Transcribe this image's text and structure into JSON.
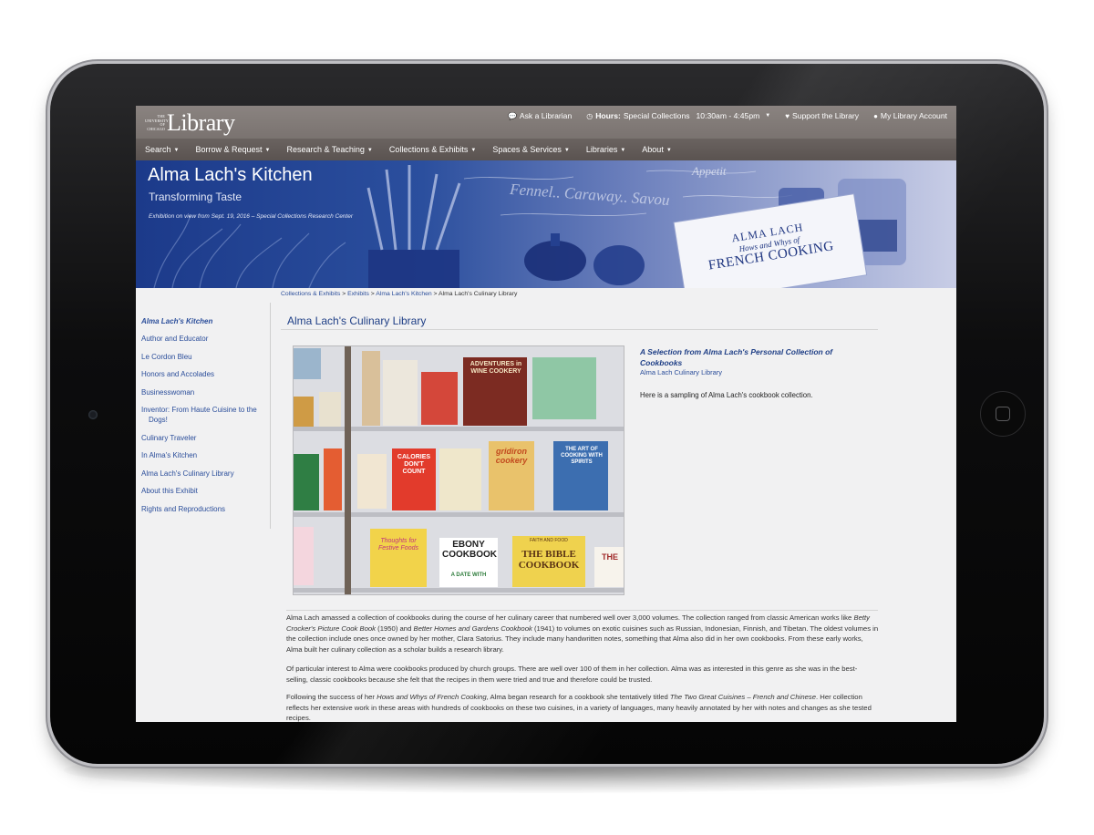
{
  "topbar": {
    "logo_small": [
      "THE",
      "UNIVERSITY",
      "OF",
      "CHICAGO"
    ],
    "logo_big": "Library",
    "ask_label": "Ask a Librarian",
    "hours_label": "Hours:",
    "hours_value": "Special Collections",
    "hours_time": "10:30am - 4:45pm",
    "support_label": "Support the Library",
    "account_label": "My Library Account"
  },
  "nav": {
    "items": [
      "Search",
      "Borrow & Request",
      "Research & Teaching",
      "Collections & Exhibits",
      "Spaces & Services",
      "Libraries",
      "About"
    ]
  },
  "banner": {
    "title": "Alma Lach's Kitchen",
    "subtitle": "Transforming Taste",
    "note": "Exhibition on view from Sept. 19, 2016 – Special Collections Research Center",
    "book_text": [
      "ALMA LACH",
      "Hows and Whys of",
      "FRENCH COOKING"
    ],
    "wall_text": [
      "Fennel.. Caraway.. Savou",
      "Appetit"
    ]
  },
  "breadcrumb": {
    "items": [
      "Collections & Exhibits",
      "Exhibits",
      "Alma Lach's Kitchen"
    ],
    "current": "Alma Lach's Culinary Library",
    "sep": " > "
  },
  "sidebar": {
    "items": [
      "Alma Lach's Kitchen",
      "Author and Educator",
      "Le Cordon Bleu",
      "Honors and Accolades",
      "Businesswoman",
      "Inventor: From Haute Cuisine to the",
      "Culinary Traveler",
      "In Alma's Kitchen",
      "Alma Lach's Culinary Library",
      "About this Exhibit",
      "Rights and Reproductions"
    ],
    "inventor_line2": "Dogs!"
  },
  "main": {
    "title": "Alma Lach's Culinary Library",
    "selection_title": "A Selection from Alma Lach's Personal Collection of Cookbooks",
    "selection_link": "Alma Lach Culinary Library",
    "selection_text": "Here is a sampling of Alma Lach's cookbook collection.",
    "book_covers": [
      "ADVENTURES in WINE COOKERY",
      "CALORIES DON'T COUNT",
      "gridiron cookery",
      "THE ART OF COOKING WITH SPIRITS",
      "EBONY COOKBOOK",
      "A DATE WITH",
      "FAITH AND FOOD",
      "THE BIBLE COOKBOOK",
      "THE",
      "Thoughts for Festive Foods"
    ],
    "p1": {
      "t1": "Alma Lach amassed a collection of cookbooks during the course of her culinary career that numbered well over 3,000 volumes.  The collection ranged from classic American works like ",
      "i1": "Betty Crocker's Picture Cook Book",
      "t2": " (1950) and ",
      "i2": "Better Homes and Gardens Cookbook",
      "t3": " (1941) to volumes on exotic cuisines such as Russian, Indonesian, Finnish, and Tibetan.  The oldest volumes in the collection include ones once owned by her mother, Clara Satorius.  They include many handwritten notes, something that Alma also did in her own cookbooks.  From these early works, Alma built her culinary collection as a scholar builds a research library."
    },
    "p2": "Of particular interest to Alma were cookbooks produced by church groups.  There are well over 100 of them in her collection.  Alma was as interested in this genre as she was in the best-selling, classic cookbooks because she felt that the recipes in them were tried and true and therefore could be trusted.",
    "p3": {
      "t1": "Following the success of her ",
      "i1": "Hows and Whys of French Cooking",
      "t2": ", Alma began research for a cookbook she tentatively titled ",
      "i2": "The Two Great Cuisines – French and Chinese",
      "t3": ".  Her collection reflects her extensive work in these areas with hundreds of cookbooks on these two cuisines, in a variety of languages, many heavily annotated by her with notes and changes as she tested recipes."
    }
  }
}
